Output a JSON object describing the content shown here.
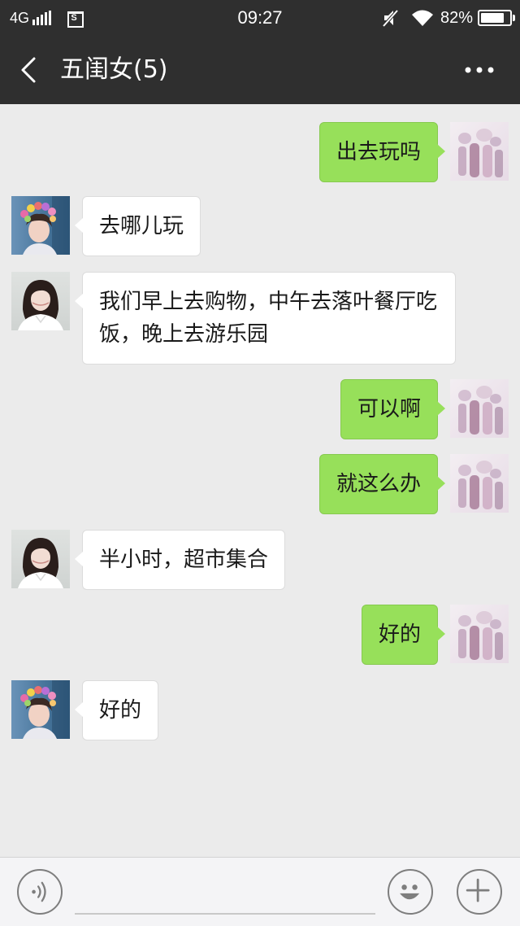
{
  "status_bar": {
    "network": "4G",
    "time": "09:27",
    "battery_percent_label": "82%",
    "battery_level": 0.82
  },
  "nav": {
    "title": "五闺女(5)"
  },
  "messages": [
    {
      "direction": "out",
      "avatar": "group-photo-avatar",
      "text": "出去玩吗"
    },
    {
      "direction": "in",
      "avatar": "flower-crown-avatar",
      "text": "去哪儿玩"
    },
    {
      "direction": "in",
      "avatar": "white-shirt-avatar",
      "text": "我们早上去购物，中午去落叶餐厅吃饭，晚上去游乐园"
    },
    {
      "direction": "out",
      "avatar": "group-photo-avatar",
      "text": "可以啊"
    },
    {
      "direction": "out",
      "avatar": "group-photo-avatar",
      "text": "就这么办"
    },
    {
      "direction": "in",
      "avatar": "white-shirt-avatar",
      "text": "半小时，超市集合"
    },
    {
      "direction": "out",
      "avatar": "group-photo-avatar",
      "text": "好的"
    },
    {
      "direction": "in",
      "avatar": "flower-crown-avatar",
      "text": "好的"
    }
  ],
  "input_bar": {
    "placeholder": "",
    "value": ""
  }
}
